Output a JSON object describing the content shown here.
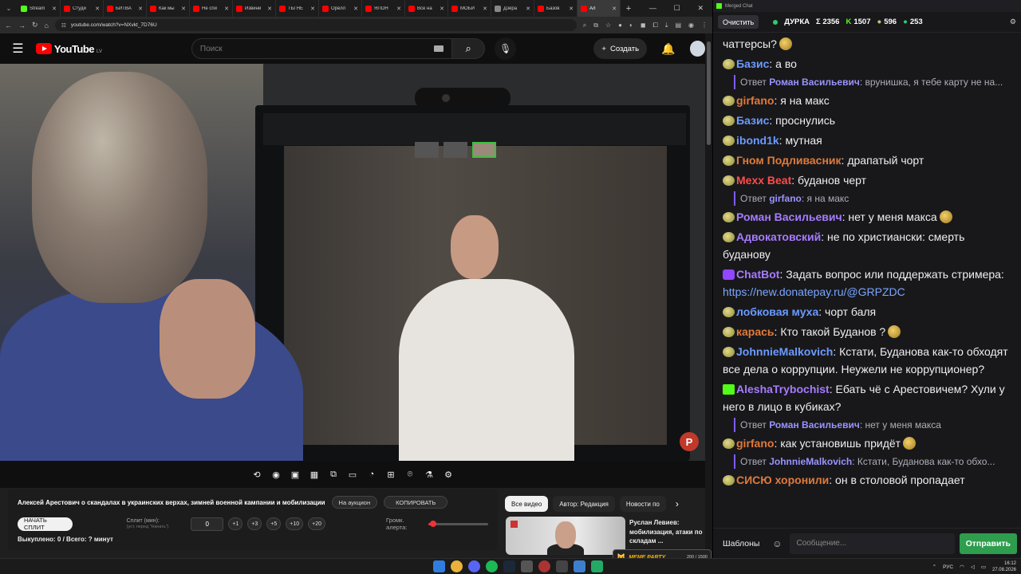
{
  "browser": {
    "tabs": [
      {
        "label": "Stream",
        "color": "#53fc18",
        "active": false
      },
      {
        "label": "Студи",
        "color": "#ff0000",
        "active": false
      },
      {
        "label": "БИТВА",
        "color": "#ff0000",
        "active": false
      },
      {
        "label": "Как мы",
        "color": "#ff0000",
        "active": false
      },
      {
        "label": "Не спи",
        "color": "#ff0000",
        "active": false
      },
      {
        "label": "Извини",
        "color": "#ff0000",
        "active": false
      },
      {
        "label": "ТЫ НЕ",
        "color": "#ff0000",
        "active": false
      },
      {
        "label": "Орелл",
        "color": "#ff0000",
        "active": false
      },
      {
        "label": "ЯПОН",
        "color": "#ff0000",
        "active": false
      },
      {
        "label": "Все на",
        "color": "#ff0000",
        "active": false
      },
      {
        "label": "МОБИ",
        "color": "#ff0000",
        "active": false
      },
      {
        "label": "Дзёра",
        "color": "#888888",
        "active": false
      },
      {
        "label": "Базов",
        "color": "#ff0000",
        "active": false
      },
      {
        "label": "Ал",
        "color": "#ff0000",
        "active": true
      }
    ],
    "url": "youtube.com/watch?v=NXvkt_7D76U"
  },
  "youtube": {
    "logo_text": "YouTube",
    "country": "LV",
    "search_placeholder": "Поиск",
    "create_label": "Создать"
  },
  "split_panel": {
    "title": "Алексей Арестович о скандалах в украинских верхах, зимней военной кампании и мобилизации",
    "auction_label": "На аукцион",
    "copy_label": "КОПИРОВАТЬ",
    "start_label": "НАЧАТЬ СПЛИТ",
    "split_label": "Сплит (мин):",
    "split_hint": "(уст. перед \"Начать\")",
    "split_value": "0",
    "increments": [
      "+1",
      "+3",
      "+5",
      "+10",
      "+20"
    ],
    "volume_label": "Громк. алерта:",
    "volume_level": 0.07,
    "bought_text": "Выкуплено: 0 / Всего: ? минут"
  },
  "recommendations": {
    "chips": [
      "Все видео",
      "Автор: Редакция",
      "Новости по"
    ],
    "video_title": "Руслан Левиев: мобилизация, атаки по складам ..."
  },
  "meme_party": {
    "label": "MEME PARTY",
    "count": "200 / 1500"
  },
  "chat": {
    "window_title": "Merged Chat",
    "clear_label": "Очистить",
    "channel": "ДУРКА",
    "stats": {
      "sum": "Σ 2356",
      "kick": "1507",
      "twitch": "596",
      "vk": "253"
    },
    "messages": [
      {
        "type": "text",
        "text": "чаттерсы?",
        "emote": true
      },
      {
        "type": "msg",
        "name": "Базис",
        "color": "#6b9bff",
        "text": "а во"
      },
      {
        "type": "reply",
        "name": "Роман Васильевич",
        "text": "врунишка, я тебе карту не на..."
      },
      {
        "type": "msg",
        "name": "girfano",
        "color": "#e07a3a",
        "text": "я на макс"
      },
      {
        "type": "msg",
        "name": "Базис",
        "color": "#6b9bff",
        "text": "проснулись"
      },
      {
        "type": "msg",
        "name": "ibond1k",
        "color": "#6b9bff",
        "text": "мутная"
      },
      {
        "type": "msg",
        "name": "Гном Подливасник",
        "color": "#e07a3a",
        "text": "драпатый чорт"
      },
      {
        "type": "msg",
        "name": "Mexx Beat",
        "color": "#ff4b4b",
        "text": "буданов черт"
      },
      {
        "type": "reply",
        "name": "girfano",
        "text": "я на макс"
      },
      {
        "type": "msg",
        "name": "Роман Васильевич",
        "color": "#a77bff",
        "text": "нет у меня макса",
        "emote": true
      },
      {
        "type": "msg",
        "name": "Адвокатовский",
        "color": "#a77bff",
        "text": "не по христиански: смерть буданову"
      },
      {
        "type": "msg",
        "name": "ChatBot",
        "color": "#a77bff",
        "text": "Задать вопрос или поддержать стримера:",
        "link": "https://new.donatepay.ru/@GRPZDC",
        "icon": "bot"
      },
      {
        "type": "msg",
        "name": "лобковая муха",
        "color": "#6b9bff",
        "text": "чорт баля"
      },
      {
        "type": "msg",
        "name": "карась",
        "color": "#e07a3a",
        "text": "Кто такой Буданов ?",
        "emote": true
      },
      {
        "type": "msg",
        "name": "JohnnieMalkovich",
        "color": "#6b9bff",
        "text": "Кстати, Буданова как-то обходят все дела о коррупции. Неужели не коррупционер?"
      },
      {
        "type": "msg",
        "name": "AleshaTrybochist",
        "color": "#a77bff",
        "text": "Ебать чё с Арестовичем? Хули у него в лицо в кубиках?",
        "icon": "kick"
      },
      {
        "type": "reply",
        "name": "Роман Васильевич",
        "text": "нет у меня макса"
      },
      {
        "type": "msg",
        "name": "girfano",
        "color": "#e07a3a",
        "text": "как установишь придёт",
        "emote": true
      },
      {
        "type": "reply",
        "name": "JohnnieMalkovich",
        "text": "Кстати, Буданова как-то обхо..."
      },
      {
        "type": "msg",
        "name": "СИСЮ хоронили",
        "color": "#e07a3a",
        "text": "он в столовой пропадает"
      }
    ],
    "reply_prefix": "Ответ",
    "templates_label": "Шаблоны",
    "input_placeholder": "Сообщение...",
    "send_label": "Отправить"
  },
  "taskbar": {
    "lang": "РУС",
    "time": "16:12",
    "date": "27.08.2026"
  }
}
